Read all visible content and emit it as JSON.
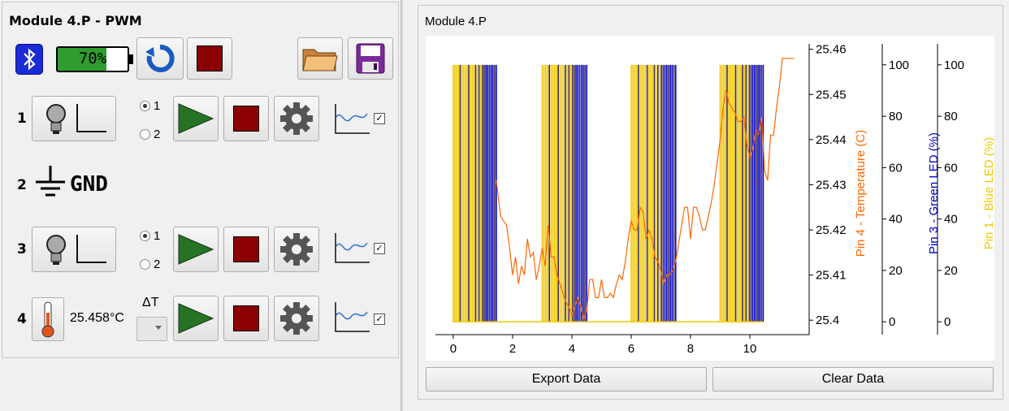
{
  "module_title": "Module 4.P - PWM",
  "toolbar": {
    "battery_label": "70%",
    "battery_level": 0.7
  },
  "rows": [
    {
      "num": "1",
      "radio_1": "1",
      "radio_2": "2"
    },
    {
      "num": "2",
      "gnd_label": "GND"
    },
    {
      "num": "3",
      "radio_1": "1",
      "radio_2": "2"
    },
    {
      "num": "4",
      "temperature": "25.458°C",
      "delta_label": "ΔT"
    }
  ],
  "checkmark": "✓",
  "plot": {
    "title": "Module 4.P",
    "export_label": "Export Data",
    "clear_label": "Clear Data"
  },
  "chart_data": {
    "type": "line",
    "xlim": [
      -0.6,
      12
    ],
    "x_ticks": [
      "0",
      "2",
      "4",
      "6",
      "8",
      "10"
    ],
    "x_tick_values": [
      0,
      2,
      4,
      6,
      8,
      10
    ],
    "temp_axis": {
      "label": "Pin 4 - Temperature (C)",
      "ticks": [
        "25.46",
        "25.45",
        "25.44",
        "25.43",
        "25.42",
        "25.41",
        "25.4"
      ],
      "tick_values": [
        25.46,
        25.45,
        25.44,
        25.43,
        25.42,
        25.41,
        25.4
      ],
      "range": [
        25.3968,
        25.4594
      ],
      "color": "#ff6600"
    },
    "green_axis": {
      "label": "Pin 3 - Green LED (%)",
      "ticks": [
        "100",
        "80",
        "60",
        "40",
        "20",
        "0"
      ],
      "tick_values": [
        100,
        80,
        60,
        40,
        20,
        0
      ],
      "range": [
        -5,
        105
      ],
      "color": "#0000cc"
    },
    "blue_axis": {
      "label": "Pin 1 - Blue LED (%)",
      "ticks": [
        "100",
        "80",
        "60",
        "40",
        "20",
        "0"
      ],
      "tick_values": [
        100,
        80,
        60,
        40,
        20,
        0
      ],
      "range": [
        -5,
        105
      ],
      "color": "#f0c800"
    },
    "pwm_windows": [
      [
        0.0,
        1.45
      ],
      [
        3.0,
        4.5
      ],
      [
        6.0,
        7.5
      ],
      [
        9.0,
        10.45
      ]
    ],
    "series": [
      {
        "name": "Pin 4 - Temperature (C)",
        "color": "#ff6600",
        "x": [
          1.45,
          1.6,
          1.8,
          1.9,
          2.0,
          2.1,
          2.2,
          2.3,
          2.4,
          2.5,
          2.6,
          2.7,
          2.8,
          2.9,
          3.0,
          3.1,
          3.2,
          3.3,
          3.4,
          3.5,
          3.6,
          3.7,
          3.8,
          3.9,
          4.0,
          4.1,
          4.2,
          4.3,
          4.4,
          4.5,
          4.6,
          4.7,
          4.8,
          4.9,
          5.0,
          5.1,
          5.2,
          5.3,
          5.4,
          5.5,
          5.6,
          5.7,
          5.8,
          5.9,
          6.0,
          6.1,
          6.2,
          6.3,
          6.4,
          6.5,
          6.6,
          6.7,
          6.8,
          6.9,
          7.0,
          7.1,
          7.2,
          7.3,
          7.4,
          7.5,
          7.6,
          7.7,
          7.8,
          7.9,
          8.0,
          8.1,
          8.2,
          8.3,
          8.4,
          8.5,
          8.6,
          8.7,
          8.8,
          8.9,
          9.0,
          9.1,
          9.2,
          9.3,
          9.4,
          9.5,
          9.6,
          9.7,
          9.8,
          9.9,
          10.0,
          10.1,
          10.2,
          10.3,
          10.4,
          10.5,
          10.6,
          10.7,
          10.8,
          10.9,
          11.0,
          11.1,
          11.2,
          11.3,
          11.4,
          11.5
        ],
        "y": [
          25.431,
          25.423,
          25.421,
          25.416,
          25.41,
          25.414,
          25.408,
          25.412,
          25.41,
          25.418,
          25.414,
          25.415,
          25.409,
          25.412,
          25.416,
          25.412,
          25.421,
          25.414,
          25.414,
          25.41,
          25.408,
          25.406,
          25.404,
          25.403,
          25.401,
          25.403,
          25.405,
          25.403,
          25.4,
          25.402,
          25.409,
          25.409,
          25.405,
          25.405,
          25.409,
          25.405,
          25.405,
          25.406,
          25.405,
          25.408,
          25.41,
          25.409,
          25.413,
          25.418,
          25.422,
          25.42,
          25.42,
          25.425,
          25.424,
          25.418,
          25.42,
          25.418,
          25.414,
          25.413,
          25.411,
          25.408,
          25.41,
          25.41,
          25.411,
          25.413,
          25.417,
          25.421,
          25.425,
          25.425,
          25.418,
          25.425,
          25.425,
          25.423,
          25.42,
          25.42,
          25.423,
          25.426,
          25.43,
          25.435,
          25.44,
          25.447,
          25.451,
          25.448,
          25.447,
          25.446,
          25.444,
          25.444,
          25.445,
          25.439,
          25.436,
          25.438,
          25.442,
          25.441,
          25.445,
          25.433,
          25.431,
          25.441,
          25.441,
          25.447,
          25.452,
          25.458,
          25.458,
          25.458,
          25.458,
          25.458
        ]
      },
      {
        "name": "Pin 3 - Green LED (%)",
        "color": "#0000cc"
      },
      {
        "name": "Pin 1 - Blue LED (%)",
        "color": "#f0c800"
      }
    ]
  }
}
